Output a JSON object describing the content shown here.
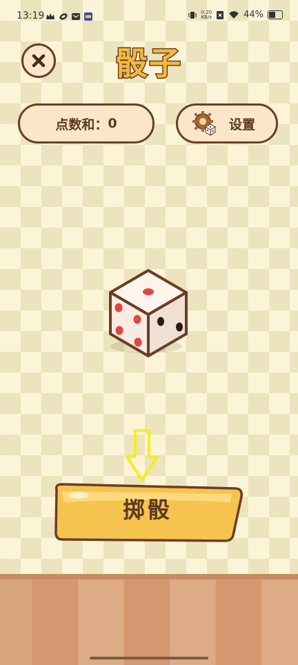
{
  "status_bar": {
    "time": "13:19",
    "net_speed_value": "0.20",
    "net_speed_unit": "KB/s",
    "battery": "44%"
  },
  "header": {
    "title": "骰子",
    "close_icon": "close-icon"
  },
  "score": {
    "label": "点数和：",
    "value": "0"
  },
  "settings": {
    "label": "设置",
    "icon": "gear-dice-icon"
  },
  "die": {
    "top_face": 1,
    "left_face": 4,
    "right_face": 2
  },
  "roll_button": {
    "label": "掷骰"
  },
  "colors": {
    "accent": "#f4b93b",
    "outline": "#6a3d26",
    "pip_red": "#e2473f",
    "background": "#fbf4d6",
    "hint_arrow": "#f5ee23"
  }
}
